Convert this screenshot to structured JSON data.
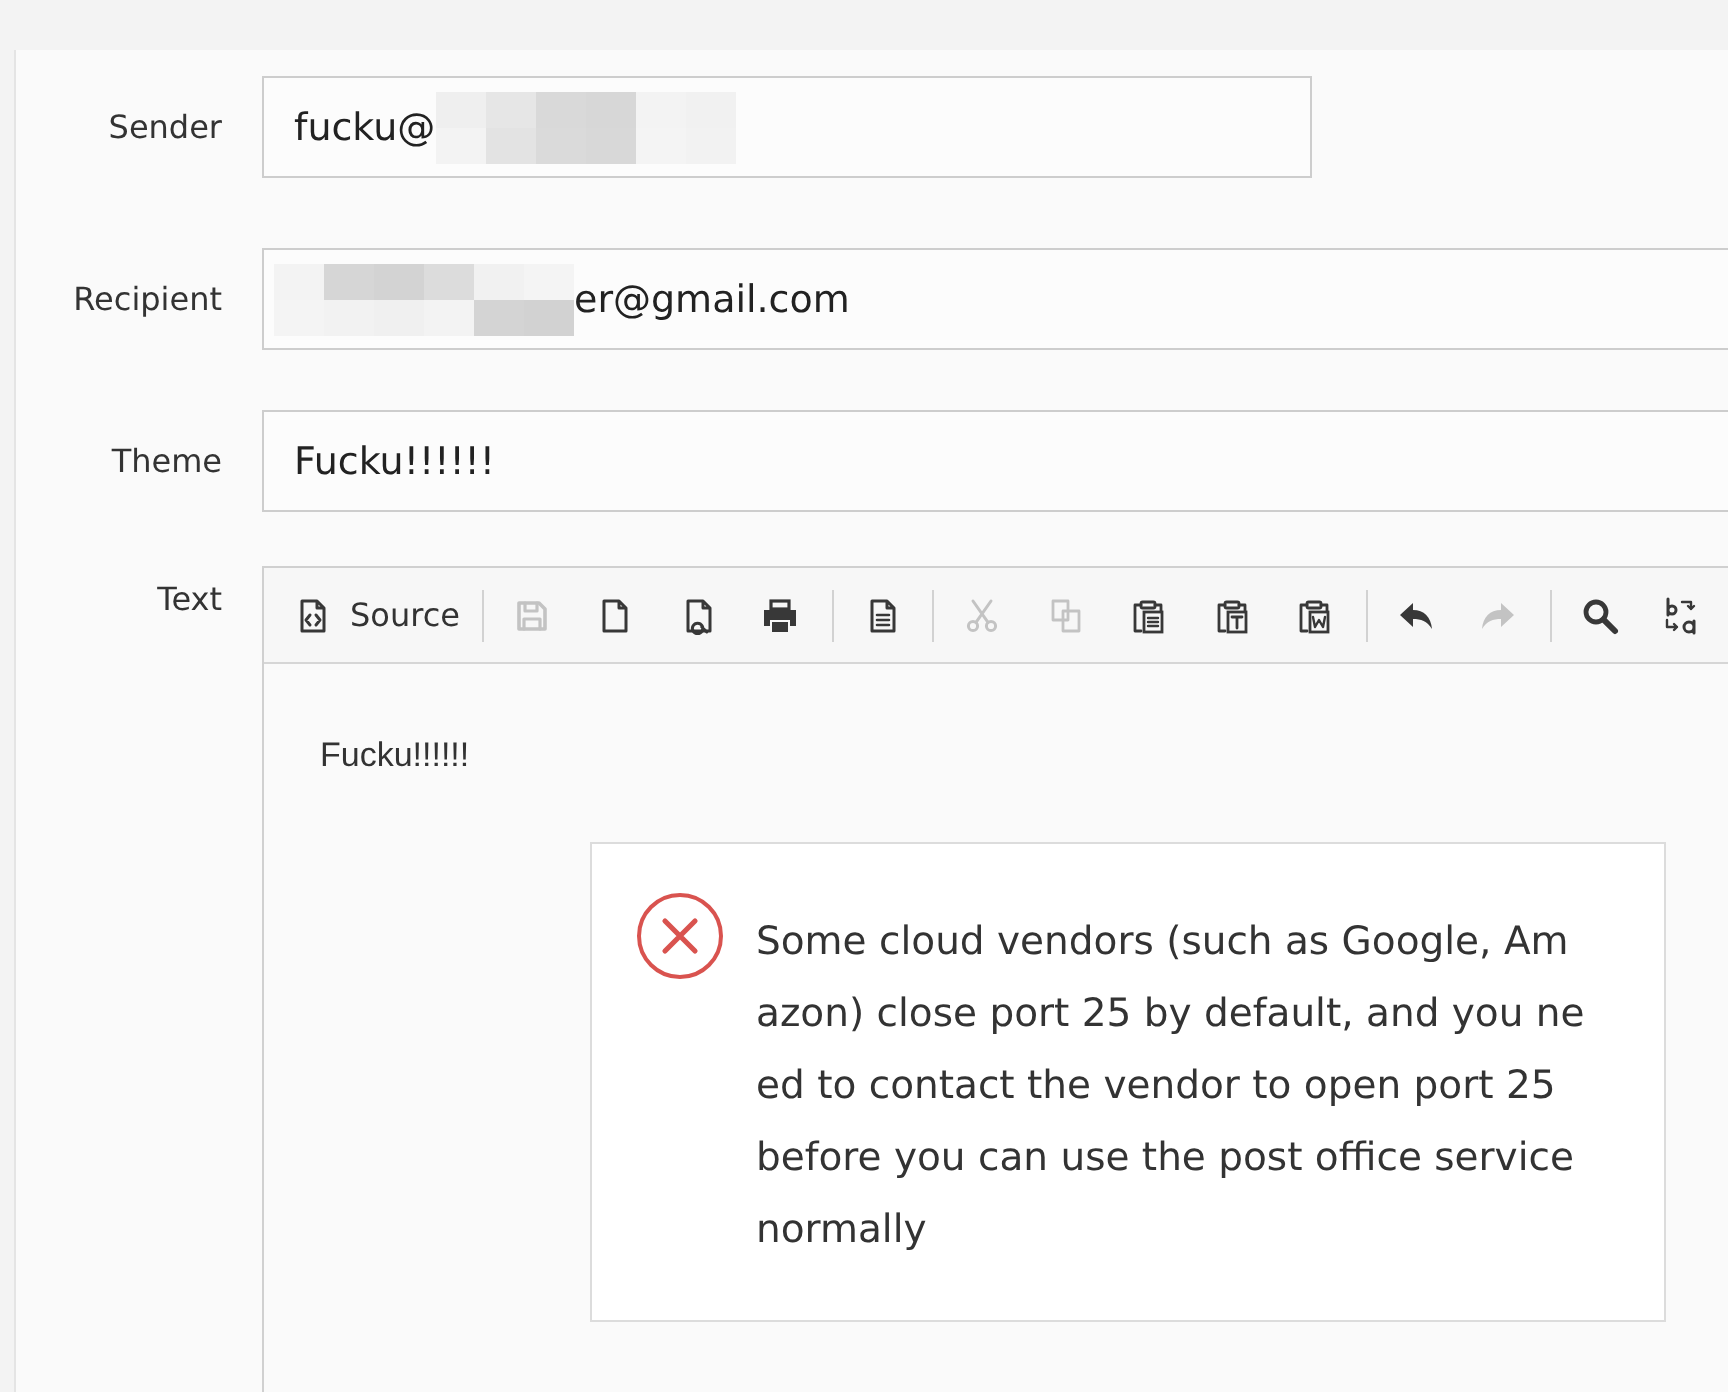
{
  "form": {
    "fields": [
      {
        "label": "Sender",
        "value": "fucku@",
        "blurred_before": false,
        "blurred_after": true
      },
      {
        "label": "Recipient",
        "value": "er@gmail.com",
        "blurred_before": true,
        "blurred_after": false
      },
      {
        "label": "Theme",
        "value": "Fucku!!!!!!",
        "blurred_before": false,
        "blurred_after": false
      }
    ],
    "editor": {
      "label": "Text",
      "toolbar_groups": [
        [
          {
            "label": "Source",
            "disabled": false
          }
        ],
        [
          {
            "disabled": true
          },
          {
            "disabled": false
          },
          {
            "disabled": false
          },
          {
            "disabled": false
          }
        ],
        [
          {
            "disabled": false
          }
        ],
        [
          {
            "disabled": true
          },
          {
            "disabled": true
          },
          {
            "disabled": false
          },
          {
            "disabled": false
          },
          {
            "disabled": false
          }
        ],
        [
          {
            "disabled": false
          },
          {
            "disabled": true
          }
        ],
        [
          {
            "disabled": false
          },
          {
            "disabled": false
          }
        ]
      ],
      "content": "Fucku!!!!!!"
    }
  },
  "error_notification": {
    "message": "Some cloud vendors (such as Google, Amazon) close port 25 by default, and you need to contact the vendor to open port 25 before you can use the post office service normally"
  }
}
